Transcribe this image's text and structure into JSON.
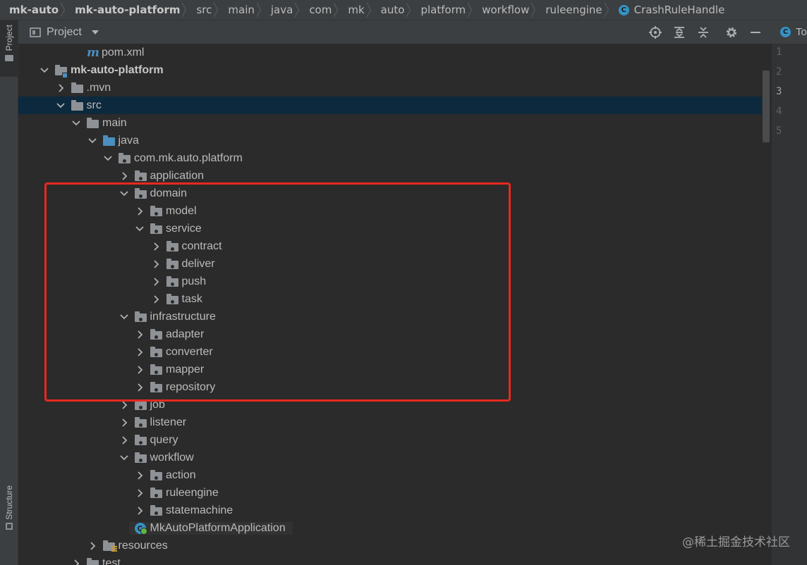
{
  "breadcrumb": [
    "mk-auto",
    "mk-auto-platform",
    "src",
    "main",
    "java",
    "com",
    "mk",
    "auto",
    "platform",
    "workflow",
    "ruleengine",
    "CrashRuleHandle"
  ],
  "left_strip": {
    "project": "Project",
    "structure": "Structure"
  },
  "panel": {
    "title": "Project"
  },
  "editor": {
    "tab_label": "To",
    "line_numbers": [
      "1",
      "2",
      "3",
      "4",
      "5"
    ],
    "current_line": "3"
  },
  "tree": [
    {
      "label": "pom.xml",
      "depth": 3,
      "icon": "maven-m",
      "chevron": "none"
    },
    {
      "label": "mk-auto-platform",
      "depth": 1,
      "icon": "module-folder",
      "chevron": "down",
      "bold": true
    },
    {
      "label": ".mvn",
      "depth": 2,
      "icon": "folder",
      "chevron": "right"
    },
    {
      "label": "src",
      "depth": 2,
      "icon": "folder",
      "chevron": "down",
      "selected": true
    },
    {
      "label": "main",
      "depth": 3,
      "icon": "folder",
      "chevron": "down"
    },
    {
      "label": "java",
      "depth": 4,
      "icon": "source-folder",
      "chevron": "down"
    },
    {
      "label": "com.mk.auto.platform",
      "depth": 5,
      "icon": "package",
      "chevron": "down"
    },
    {
      "label": "application",
      "depth": 6,
      "icon": "package",
      "chevron": "right"
    },
    {
      "label": "domain",
      "depth": 6,
      "icon": "package",
      "chevron": "down"
    },
    {
      "label": "model",
      "depth": 7,
      "icon": "package",
      "chevron": "right"
    },
    {
      "label": "service",
      "depth": 7,
      "icon": "package",
      "chevron": "down"
    },
    {
      "label": "contract",
      "depth": 8,
      "icon": "package",
      "chevron": "right"
    },
    {
      "label": "deliver",
      "depth": 8,
      "icon": "package",
      "chevron": "right"
    },
    {
      "label": "push",
      "depth": 8,
      "icon": "package",
      "chevron": "right"
    },
    {
      "label": "task",
      "depth": 8,
      "icon": "package",
      "chevron": "right"
    },
    {
      "label": "infrastructure",
      "depth": 6,
      "icon": "package",
      "chevron": "down"
    },
    {
      "label": "adapter",
      "depth": 7,
      "icon": "package",
      "chevron": "right"
    },
    {
      "label": "converter",
      "depth": 7,
      "icon": "package",
      "chevron": "right"
    },
    {
      "label": "mapper",
      "depth": 7,
      "icon": "package",
      "chevron": "right"
    },
    {
      "label": "repository",
      "depth": 7,
      "icon": "package",
      "chevron": "right"
    },
    {
      "label": "job",
      "depth": 6,
      "icon": "package",
      "chevron": "right"
    },
    {
      "label": "listener",
      "depth": 6,
      "icon": "package",
      "chevron": "right"
    },
    {
      "label": "query",
      "depth": 6,
      "icon": "package",
      "chevron": "right"
    },
    {
      "label": "workflow",
      "depth": 6,
      "icon": "package",
      "chevron": "down"
    },
    {
      "label": "action",
      "depth": 7,
      "icon": "package",
      "chevron": "right"
    },
    {
      "label": "ruleengine",
      "depth": 7,
      "icon": "package",
      "chevron": "right"
    },
    {
      "label": "statemachine",
      "depth": 7,
      "icon": "package",
      "chevron": "right"
    },
    {
      "label": "MkAutoPlatformApplication",
      "depth": 6,
      "icon": "spring-app-class",
      "chevron": "none",
      "highlighted": true
    },
    {
      "label": "resources",
      "depth": 4,
      "icon": "resources-folder",
      "chevron": "right"
    },
    {
      "label": "test",
      "depth": 3,
      "icon": "folder",
      "chevron": "right"
    }
  ],
  "watermark": "@稀土掘金技术社区",
  "colors": {
    "background": "#2b2b2b",
    "panel_header": "#3c3f41",
    "selection": "#0d293e",
    "folder": "#8e9296",
    "source_folder": "#4a8fbf",
    "class_icon": "#3592c4",
    "annotation_box": "#e8291e"
  }
}
